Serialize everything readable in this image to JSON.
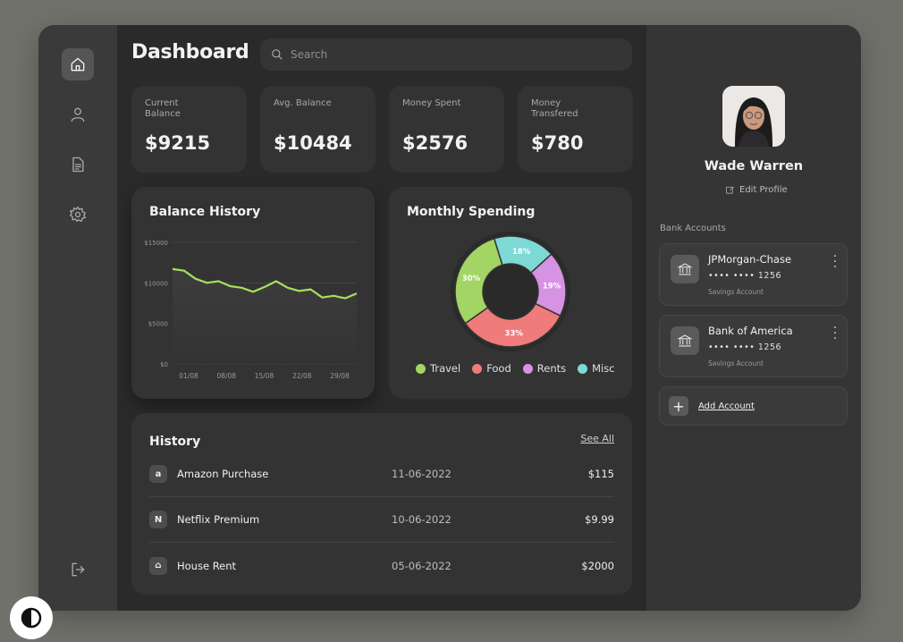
{
  "header": {
    "title": "Dashboard"
  },
  "search": {
    "placeholder": "Search"
  },
  "sidebar": {
    "items": [
      {
        "name": "home",
        "icon": "home-icon",
        "active": true
      },
      {
        "name": "profile",
        "icon": "user-icon",
        "active": false
      },
      {
        "name": "documents",
        "icon": "document-icon",
        "active": false
      },
      {
        "name": "settings",
        "icon": "gear-icon",
        "active": false
      }
    ],
    "logout_icon": "logout-icon"
  },
  "stats": [
    {
      "label": "Current Balance",
      "value": "$9215"
    },
    {
      "label": "Avg. Balance",
      "value": "$10484"
    },
    {
      "label": "Money Spent",
      "value": "$2576"
    },
    {
      "label": "Money Transfered",
      "value": "$780"
    }
  ],
  "chart_data": [
    {
      "type": "area",
      "title": "Balance History",
      "x": [
        "01/08",
        "08/08",
        "15/08",
        "22/08",
        "29/08"
      ],
      "y_ticks": [
        "$15000",
        "$10000",
        "$5000",
        "$0"
      ],
      "ylim": [
        0,
        15000
      ],
      "series": [
        {
          "values": [
            11700,
            11500,
            10500,
            10000,
            10200,
            9600,
            9400,
            8900,
            9500,
            10200,
            9400,
            9000,
            9200,
            8200,
            8400,
            8100,
            8700
          ]
        }
      ],
      "line_color": "#a6e05c",
      "grid": true
    },
    {
      "type": "pie",
      "title": "Monthly Spending",
      "donut": true,
      "slices": [
        {
          "label": "Travel",
          "value": 30,
          "label_text": "30%",
          "color": "#a2d563"
        },
        {
          "label": "Food",
          "value": 33,
          "label_text": "33%",
          "color": "#ef7b7b"
        },
        {
          "label": "Rents",
          "value": 19,
          "label_text": "19%",
          "color": "#d793e3"
        },
        {
          "label": "Misc",
          "value": 18,
          "label_text": "18%",
          "color": "#7ed8d4"
        }
      ],
      "legend": [
        "Travel",
        "Food",
        "Rents",
        "Misc"
      ]
    }
  ],
  "history": {
    "title": "History",
    "see_all": "See All",
    "rows": [
      {
        "icon": "amazon-icon",
        "glyph": "a",
        "name": "Amazon Purchase",
        "date": "11-06-2022",
        "amount": "$115"
      },
      {
        "icon": "netflix-icon",
        "glyph": "N",
        "name": "Netflix Premium",
        "date": "10-06-2022",
        "amount": "$9.99"
      },
      {
        "icon": "house-icon",
        "glyph": "⌂",
        "name": "House Rent",
        "date": "05-06-2022",
        "amount": "$2000"
      }
    ]
  },
  "profile": {
    "name": "Wade Warren",
    "edit_label": "Edit Profile",
    "bank_heading": "Bank Accounts",
    "banks": [
      {
        "name": "JPMorgan-Chase",
        "number": "•••• •••• 1256",
        "type": "Savings Account"
      },
      {
        "name": "Bank of America",
        "number": "•••• •••• 1256",
        "type": "Savings Account"
      }
    ],
    "add_label": "Add Account"
  },
  "colors": {
    "accent_green": "#a6e05c",
    "panel": "#333333",
    "background": "#6f716a"
  }
}
